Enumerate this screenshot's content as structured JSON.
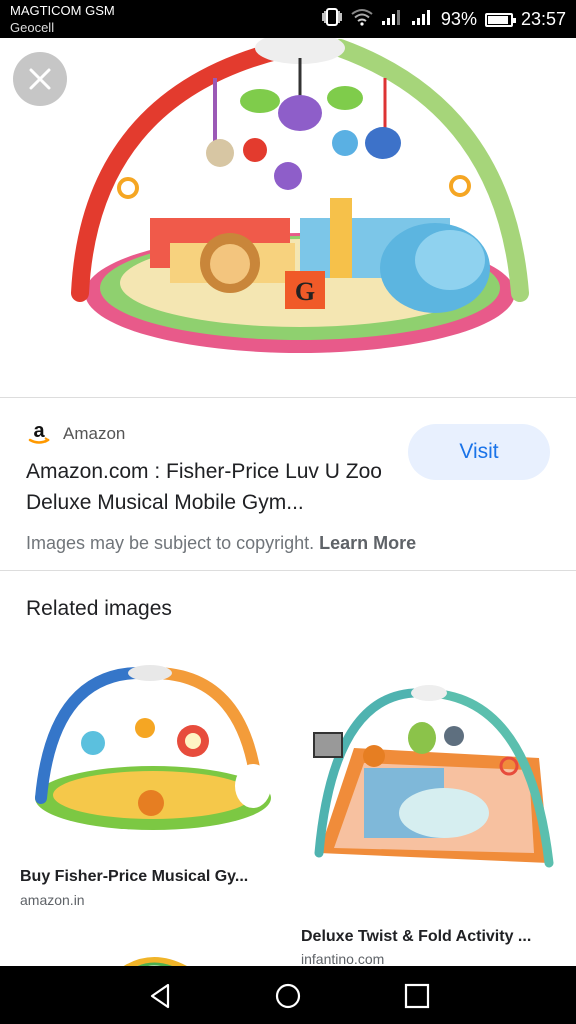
{
  "status_bar": {
    "carrier_primary": "MAGTICOM GSM",
    "carrier_secondary": "Geocell",
    "battery_percent": "93%",
    "battery_level": 0.93,
    "time": "23:57"
  },
  "result": {
    "source_name": "Amazon",
    "title": "Amazon.com : Fisher-Price Luv U Zoo Deluxe Musical Mobile Gym...",
    "visit_label": "Visit",
    "copyright_text": "Images may be subject to copyright.",
    "learn_more_label": "Learn More"
  },
  "related": {
    "heading": "Related images",
    "items": [
      {
        "title": "Buy Fisher-Price Musical Gy...",
        "source": "amazon.in"
      },
      {
        "title": "Deluxe Twist & Fold Activity ...",
        "source": "infantino.com"
      }
    ]
  },
  "icons": {
    "close": "close-icon",
    "source_logo": "amazon-logo-icon",
    "nav": [
      "back-icon",
      "home-icon",
      "recents-icon"
    ]
  },
  "colors": {
    "accent": "#1a73e8",
    "visit_bg": "#e8f0fe"
  }
}
